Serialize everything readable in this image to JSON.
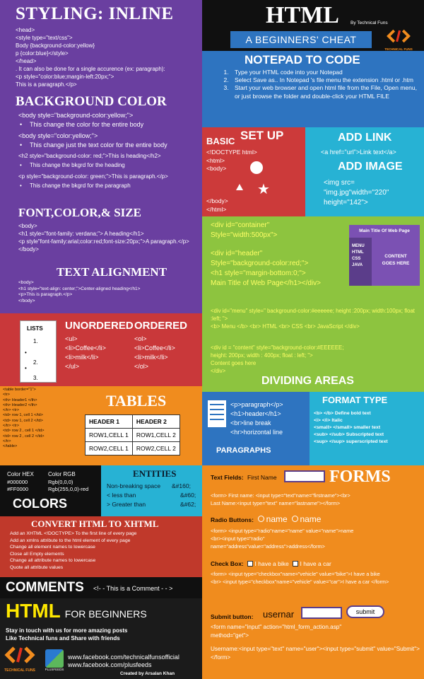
{
  "inline": {
    "title": "STYLING: INLINE",
    "code1": "<head>\n<style type=\"text/css\">\nBody {background-color:yellow}\np {color:blue}</style>\n</head>\n. It can also be done for a single accurence (ex: paragraph):\n<p style=\"color:blue;margin-left:20px;\">\nThis is a paragraph.</p>"
  },
  "bgcolor": {
    "title": "BACKGROUND COLOR",
    "l1": "<body style=\"background-color:yellow;\">",
    "b1": "This change the color for the entire body",
    "l2": "<body style=\"color:yellow;\">",
    "b2": "This change just the text color for the entire body",
    "l3": "<h2 style=\"background-color: red;\">This is heading</h2>",
    "b3": "This change the bkgrd for the heading",
    "l4": "<p style=\"background-color: green;\">This is paragraph.</p>",
    "b4": "This change the bkgrd for the paragraph"
  },
  "font": {
    "title": "FONT,COLOR,& SIZE",
    "code": "<body>\n<h1 style=\"font-family: verdana;\"> A heading</h1>\n <p style\"font-family:arial;color:red;font-size:20px;\">A paragraph.</p>\n </body>"
  },
  "align": {
    "title": "TEXT ALIGNMENT",
    "code": "<body>\n<h1 style=\"text-align: center;\">Center-aligned heading</h1>\n<p>This is paragraph.</p>\n</body>"
  },
  "header": {
    "title": "HTML",
    "by": "By Technical Funs",
    "subtitle": "A BEGINNERS' CHEAT SHEET",
    "logo_text": "TECHNICAL FUNS"
  },
  "notepad": {
    "title": "NOTEPAD TO CODE",
    "steps": [
      "Type your HTML code into your Notepad",
      "Select Save as.. In Notepad 's file menu the extension .html or .htm",
      "Start your web browser and open html file from the File, Open menu, or just browse the folder and double-click your HTML FILE"
    ]
  },
  "setup": {
    "basic": "BASIC",
    "title": "SET UP",
    "code": "<!DOCTYPE html>\n<html>\n<body>\n\n\n\n</body>\n</html>"
  },
  "link": {
    "title": "ADD LINK",
    "code": "<a href=\"url\">Link text</a>"
  },
  "image": {
    "title": "ADD IMAGE",
    "code": "<img src=\n\"img.jpg\"width=\"220\"\nheight=\"142\">"
  },
  "dividing": {
    "c1": "<div id=\"container\"\nStyle=\"width:500px\">",
    "c2": "<div id=\"header\"\nStyle=\"background-color:red;\">\n<h1 style=\"margin-bottom:0;\">\nMain Title of Web Page</h1></div>",
    "c3": "<div id=\"menu\" style=\" background-color:#eeeeee; height :200px; width:100px; float :left; \">\n<b> Menu </b> <br> HTML <br> CSS <br> JavaScript </div>",
    "c4": "<div id = \"content\" style=\"background-color:#EEEEEE;\nheight: 200px; width : 400px; float : left; \">\nContent goes here\n</div>",
    "title": "DIVIDING AREAS",
    "diagram_title": "Main Title Of Web Page",
    "diagram_menu": "MENU\nHTML\nCSS\nJAVA",
    "diagram_content": "CONTENT\nGOES HERE"
  },
  "lists": {
    "box_label": "LISTS",
    "box_items": [
      "1.",
      "2.",
      "3."
    ],
    "unordered_title": "UNORDERED",
    "unordered_code": "<ul>\n<li>Coffee</li>\n<li>milk</li>\n</ul>",
    "ordered_title": "ORDERED",
    "ordered_code": "<ol>\n<li>Coffee</li>\n<li>milk</li>\n</ol>"
  },
  "tables": {
    "code": "<table border=\"1\">\n<tr>\n<th> Header1 </th>\n<th> Header2 </th>\n</tr> <tr>\n<td> row 1, cell 1 </td>\n<td> row 1, cell 2 </td>\n</tr> <tr>\n<td> row 2 , cell 1 </td>\n<td> row 2 , cell 2 </td>\n</tr>\n</table>",
    "title": "TABLES",
    "headers": [
      "HEADER 1",
      "HEADER 2"
    ],
    "rows": [
      [
        "ROW1,CELL 1",
        "ROW1,CELL 2"
      ],
      [
        "ROW2,CELL 1",
        "ROW2,CELL 2"
      ]
    ]
  },
  "paragraphs": {
    "code": "<p>paragraph</p>\n<h1>header</h1>\n<br>line break\n<hr>horizontal line",
    "title": "PARAGRAPHS"
  },
  "format": {
    "title": "FORMAT TYPE",
    "code": "<b> </b> Define bold text\n<i> </i>      Italic\n<small> </small>  smaller text\n<sub> </sub> Subscripted text\n<sup> </sup> superscripted text"
  },
  "colors": {
    "hex_label": "Color HEX",
    "hex": "#000000\n#FF0000",
    "rgb_label": "Color RGB",
    "rgb": "Rgb(0,0,0)\nRgb(255,0,0)-red",
    "title": "COLORS"
  },
  "entities": {
    "title": "ENTITIES",
    "rows": [
      [
        "Non-breaking space",
        "&#160;"
      ],
      [
        "< less than",
        "&#60;"
      ],
      [
        "> Greater than",
        "&#62;"
      ]
    ]
  },
  "convert": {
    "title": "CONVERT HTML TO XHTML",
    "lines": "Add an XHTML <!DOCTYPE> To the first line of every page\nAdd an xmlns attribute to the html element of every page\nChange all element names to lowercase\nClose all Empty elements\nChange all attribute names to lowercase\nQuote all attribute values"
  },
  "comments": {
    "title": "COMMENTS",
    "code": "<!- - This is a Comment - - >"
  },
  "footer": {
    "title": "HTML",
    "title_small": "FOR BEGINNERS",
    "line": "Stay in touch with us for more amazing posts\nLike Technical funs and Share with friends",
    "links": "www.facebook.com/technicalfunsofficial\nwww.facebook.com/plusfeeds",
    "logo1": "TECHNICAL FUNS",
    "logo2": "PLUSFEEDS",
    "credit": "Created by Arsalan Khan"
  },
  "forms": {
    "textfield_label": "Text Fields:",
    "first_name": "First Name",
    "title": "FORMS",
    "text_code": "<form> First name: <input type=\"text\"name=\"firstname\"><br>\nLast Name:<input type=\"text\" name=\"lastname\"></form>",
    "radio_label": "Radio Buttons:",
    "radio_options": [
      "name",
      "name"
    ],
    "radio_code": "<form> <input type=\"radio\"name=\"name\" value=\"name\">name\n<br><input type=\"radio\"\nname=\"address\"value=\"address\">address</form>",
    "checkbox_label": "Check Box:",
    "check_options": [
      "I have a bike",
      "I have a car"
    ],
    "checkbox_code": "<form> <input type=\"checkbox\"name=\"vehicle\" value=\"bike\">I have a bike\n<br> <input type=\"checkbox\"name=\"vehicle\" value=\"car\">I have a car </form>",
    "submit_label": "Submit button:",
    "username": "usernar",
    "submit": "submit",
    "submit_code1": "<form name=\"input\" action=\"html_form_action.asp\"\nmethod=\"get\">",
    "submit_code2": "Username:<input type=\"text\" name=\"user\"><input type=\"submit\" value=\"Submit\"></form>"
  },
  "colors_palette": {
    "purple": "#6a3fa0",
    "black": "#101010",
    "blue": "#2e74c0",
    "red": "#cc3a3a",
    "cyan": "#27b2d4",
    "green": "#8dc43f",
    "orange": "#f08c1e",
    "darkred": "#c0392b",
    "dark": "#1b1b1b"
  }
}
